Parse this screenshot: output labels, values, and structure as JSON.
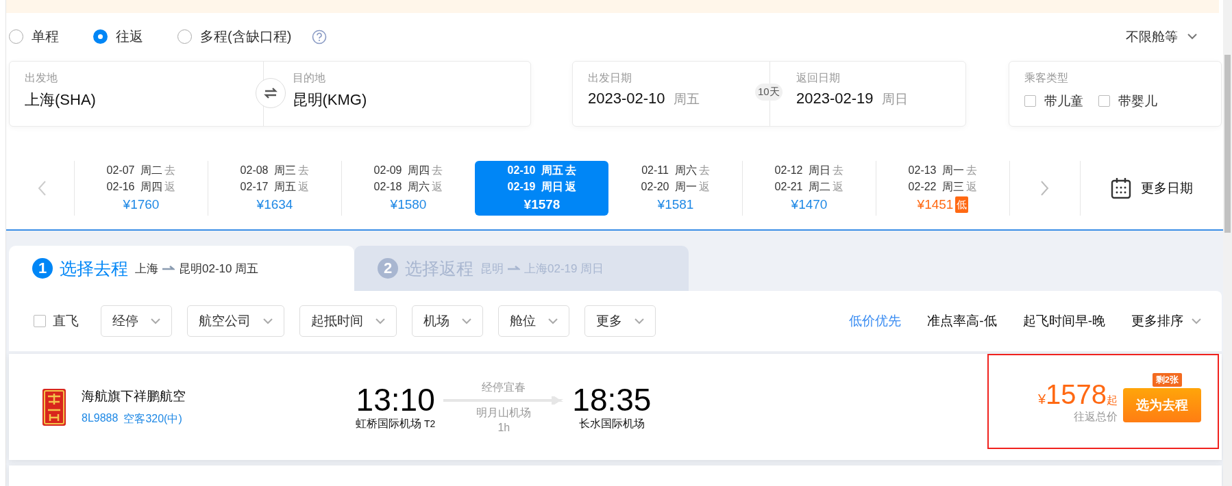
{
  "trip_types": [
    {
      "label": "单程",
      "selected": false
    },
    {
      "label": "往返",
      "selected": true
    },
    {
      "label": "多程(含缺口程)",
      "selected": false
    }
  ],
  "cabin_class": {
    "label": "不限舱等"
  },
  "route": {
    "from": {
      "label": "出发地",
      "value": "上海(SHA)"
    },
    "to": {
      "label": "目的地",
      "value": "昆明(KMG)"
    }
  },
  "dates": {
    "depart": {
      "label": "出发日期",
      "date": "2023-02-10",
      "weekday": "周五"
    },
    "duration": "10天",
    "return": {
      "label": "返回日期",
      "date": "2023-02-19",
      "weekday": "周日"
    }
  },
  "passengers": {
    "label": "乘客类型",
    "options": [
      {
        "label": "带儿童",
        "checked": false
      },
      {
        "label": "带婴儿",
        "checked": false
      }
    ]
  },
  "date_strip": {
    "items": [
      {
        "depart_date": "02-07",
        "depart_weekday": "周二",
        "depart_tag": "去",
        "return_date": "02-16",
        "return_weekday": "周四",
        "return_tag": "返",
        "price": "¥1760",
        "selected": false
      },
      {
        "depart_date": "02-08",
        "depart_weekday": "周三",
        "depart_tag": "去",
        "return_date": "02-17",
        "return_weekday": "周五",
        "return_tag": "返",
        "price": "¥1634",
        "selected": false
      },
      {
        "depart_date": "02-09",
        "depart_weekday": "周四",
        "depart_tag": "去",
        "return_date": "02-18",
        "return_weekday": "周六",
        "return_tag": "返",
        "price": "¥1580",
        "selected": false
      },
      {
        "depart_date": "02-10",
        "depart_weekday": "周五",
        "depart_tag": "去",
        "return_date": "02-19",
        "return_weekday": "周日",
        "return_tag": "返",
        "price": "¥1578",
        "selected": true
      },
      {
        "depart_date": "02-11",
        "depart_weekday": "周六",
        "depart_tag": "去",
        "return_date": "02-20",
        "return_weekday": "周一",
        "return_tag": "返",
        "price": "¥1581",
        "selected": false
      },
      {
        "depart_date": "02-12",
        "depart_weekday": "周日",
        "depart_tag": "去",
        "return_date": "02-21",
        "return_weekday": "周二",
        "return_tag": "返",
        "price": "¥1470",
        "selected": false
      },
      {
        "depart_date": "02-13",
        "depart_weekday": "周一",
        "depart_tag": "去",
        "return_date": "02-22",
        "return_weekday": "周三",
        "return_tag": "返",
        "price": "¥1451",
        "selected": false,
        "badge": "低"
      }
    ],
    "more": "更多日期"
  },
  "steps": [
    {
      "number": "1",
      "title": "选择去程",
      "from": "上海",
      "to": "昆明02-10 周五",
      "selected": true
    },
    {
      "number": "2",
      "title": "选择返程",
      "from": "昆明",
      "to": "上海02-19 周日",
      "selected": false
    }
  ],
  "filters": {
    "direct": {
      "label": "直飞",
      "checked": false
    },
    "dropdowns": [
      "经停",
      "航空公司",
      "起抵时间",
      "机场",
      "舱位",
      "更多"
    ]
  },
  "sorts": [
    {
      "label": "低价优先",
      "kind": "option",
      "selected": true
    },
    {
      "label": "准点率高-低",
      "kind": "option",
      "selected": false
    },
    {
      "label": "起飞时间早-晚",
      "kind": "option",
      "selected": false
    },
    {
      "label": "更多排序",
      "kind": "menu",
      "selected": false
    }
  ],
  "flights": [
    {
      "airline": "海航旗下祥鹏航空",
      "flight_no": "8L9888",
      "aircraft": "空客320(中)",
      "depart_time": "13:10",
      "depart_airport": "虹桥国际机场",
      "depart_terminal": "T2",
      "stop_label": "经停宜春",
      "stop_airport": "明月山机场",
      "stop_duration": "1h",
      "arrive_time": "18:35",
      "arrive_airport": "长水国际机场",
      "currency": "¥",
      "price": "1578",
      "price_suffix": "起",
      "price_note": "往返总价",
      "remaining": "剩2张",
      "button": "选为去程",
      "highlighted": true
    }
  ]
}
